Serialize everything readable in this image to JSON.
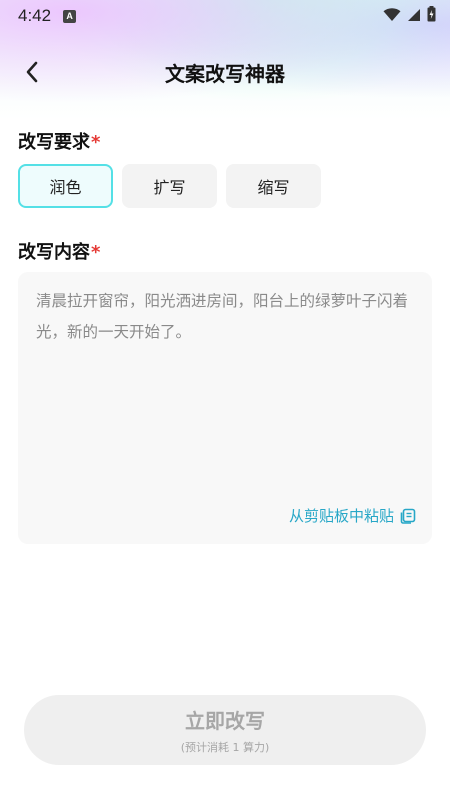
{
  "status_bar": {
    "time": "4:42",
    "a_icon": "A"
  },
  "header": {
    "title": "文案改写神器"
  },
  "requirements": {
    "label": "改写要求",
    "required_mark": "*",
    "options": [
      {
        "label": "润色",
        "selected": true
      },
      {
        "label": "扩写",
        "selected": false
      },
      {
        "label": "缩写",
        "selected": false
      }
    ]
  },
  "content": {
    "label": "改写内容",
    "required_mark": "*",
    "placeholder": "清晨拉开窗帘，阳光洒进房间，阳台上的绿萝叶子闪着光，新的一天开始了。",
    "paste_label": "从剪贴板中粘贴"
  },
  "submit": {
    "label": "立即改写",
    "sub_label": "(预计消耗 1 算力)"
  },
  "colors": {
    "accent": "#54e0e6",
    "link": "#27a7c7",
    "required": "#e53935"
  }
}
